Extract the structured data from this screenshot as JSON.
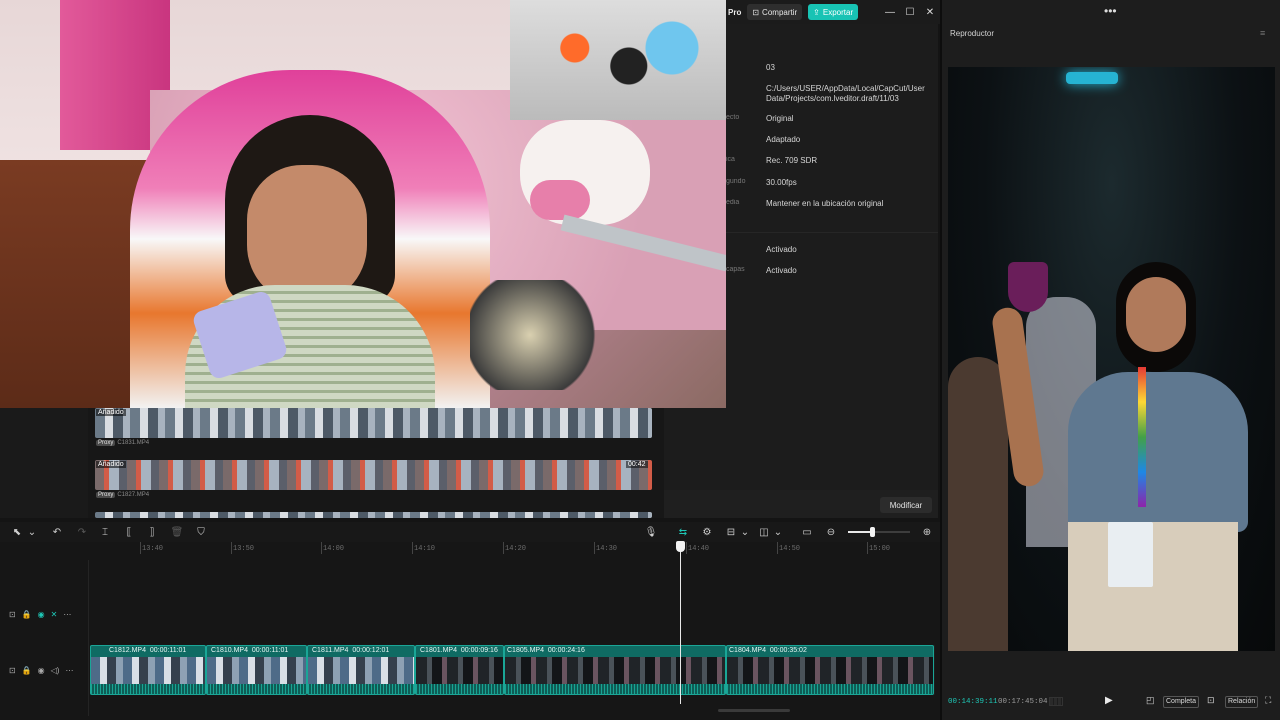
{
  "titlebar": {
    "pro_label": "Pro",
    "share_label": "Compartir",
    "export_label": "Exportar"
  },
  "details": {
    "rows": [
      {
        "label": "",
        "value": "03"
      },
      {
        "label": "",
        "value": "C:/Users/USER/AppData/Local/CapCut/User Data/Projects/com.lveditor.draft/11/03"
      },
      {
        "label": "ecto",
        "value": "Original"
      },
      {
        "label": "",
        "value": "Adaptado"
      },
      {
        "label": "ica",
        "value": "Rec. 709 SDR"
      },
      {
        "label": "gundo",
        "value": "30.00fps"
      },
      {
        "label": "edia",
        "value": "Mantener en la ubicación original"
      },
      {
        "label": "",
        "value": "Activado"
      },
      {
        "label": "capas",
        "value": "Activado"
      }
    ],
    "modify_label": "Modificar"
  },
  "media": {
    "strips": [
      {
        "tag": "Añadido",
        "proxy": "Proxy",
        "file": "C1831.MP4",
        "duration": ""
      },
      {
        "tag": "Añadido",
        "proxy": "Proxy",
        "file": "C1827.MP4",
        "duration": "00:42"
      }
    ]
  },
  "ruler": [
    "13:40",
    "13:50",
    "14:00",
    "14:10",
    "14:20",
    "14:30",
    "14:40",
    "14:50",
    "15:00"
  ],
  "timeline": {
    "clips": [
      {
        "name": "C1812.MP4",
        "duration": "00:00:11:01"
      },
      {
        "name": "C1810.MP4",
        "duration": "00:00:11:01"
      },
      {
        "name": "C1811.MP4",
        "duration": "00:00:12:01"
      },
      {
        "name": "C1801.MP4",
        "duration": "00:00:09:16"
      },
      {
        "name": "C1805.MP4",
        "duration": "00:00:24:16"
      },
      {
        "name": "C1804.MP4",
        "duration": "00:00:35:02"
      }
    ]
  },
  "player": {
    "title": "Reproductor",
    "current_time": "00:14:39:11",
    "total_time": "00:17:45:04",
    "full_label": "Completa",
    "ratio_label": "Relación"
  },
  "colors": {
    "accent": "#1ec7b6",
    "export_button": "#18c3b4",
    "clip_fill": "#0f6b63"
  }
}
